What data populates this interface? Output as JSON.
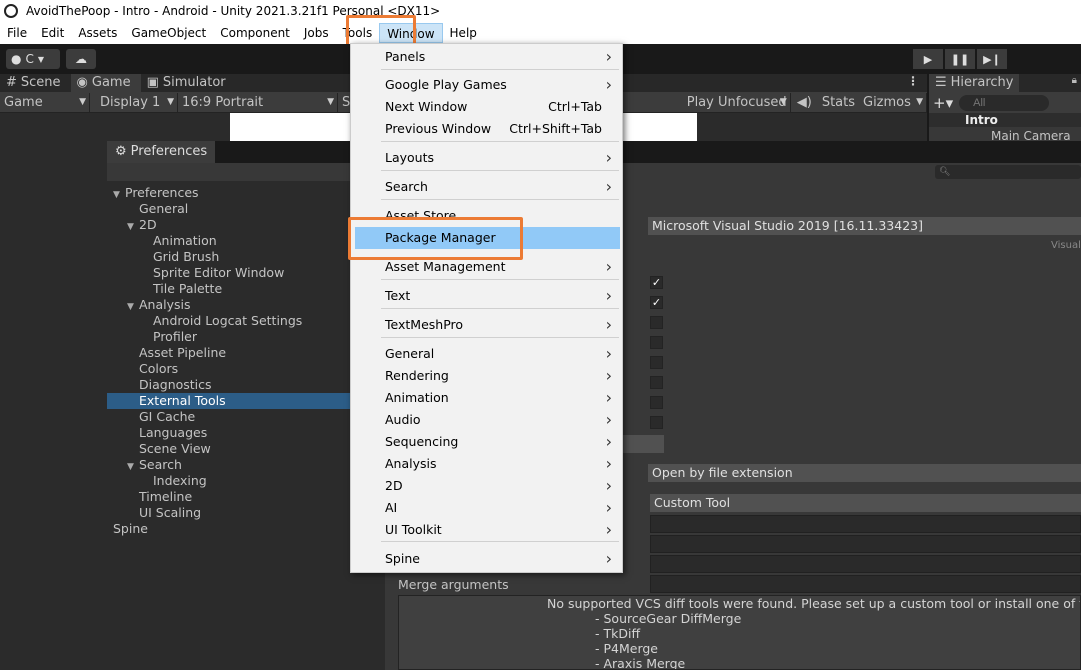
{
  "title": "AvoidThePoop - Intro - Android - Unity 2021.3.21f1 Personal <DX11>",
  "menubar": [
    "File",
    "Edit",
    "Assets",
    "GameObject",
    "Component",
    "Jobs",
    "Tools",
    "Window",
    "Help"
  ],
  "toolbar": {
    "account_initial": "C"
  },
  "tabs": {
    "scene": "Scene",
    "game": "Game",
    "simulator": "Simulator"
  },
  "gamebar": {
    "mode": "Game",
    "display": "Display 1",
    "aspect": "16:9 Portrait",
    "scale_fragment": "S",
    "play_focus": "Play Unfocused",
    "stats": "Stats",
    "gizmos": "Gizmos"
  },
  "hierarchy": {
    "tab": "Hierarchy",
    "search_placeholder": "All",
    "scene": "Intro",
    "camera": "Main Camera"
  },
  "preferences": {
    "tab": "Preferences",
    "tree": [
      {
        "label": "Preferences",
        "level": 0,
        "arrow": true
      },
      {
        "label": "General",
        "level": 1
      },
      {
        "label": "2D",
        "level": 1,
        "arrow": true
      },
      {
        "label": "Animation",
        "level": 2
      },
      {
        "label": "Grid Brush",
        "level": 2
      },
      {
        "label": "Sprite Editor Window",
        "level": 2
      },
      {
        "label": "Tile Palette",
        "level": 2
      },
      {
        "label": "Analysis",
        "level": 1,
        "arrow": true
      },
      {
        "label": "Android Logcat Settings",
        "level": 2
      },
      {
        "label": "Profiler",
        "level": 2
      },
      {
        "label": "Asset Pipeline",
        "level": 1
      },
      {
        "label": "Colors",
        "level": 1
      },
      {
        "label": "Diagnostics",
        "level": 1
      },
      {
        "label": "External Tools",
        "level": 1,
        "selected": true
      },
      {
        "label": "GI Cache",
        "level": 1
      },
      {
        "label": "Languages",
        "level": 1
      },
      {
        "label": "Scene View",
        "level": 1
      },
      {
        "label": "Search",
        "level": 1,
        "arrow": true
      },
      {
        "label": "Indexing",
        "level": 2
      },
      {
        "label": "Timeline",
        "level": 1
      },
      {
        "label": "UI Scaling",
        "level": 1
      },
      {
        "label": "Spine",
        "level": 0
      }
    ],
    "editor_value": "Microsoft Visual Studio 2019 [16.11.33423]",
    "editor_hint": "Visual",
    "checkboxes": [
      true,
      true,
      false,
      false,
      false,
      false,
      false,
      false
    ],
    "open_by": "Open by file extension",
    "tool": "Custom Tool",
    "merge_label": "Merge arguments",
    "message": [
      "No supported VCS diff tools were found. Please set up a custom tool or install one of the followin",
      "- SourceGear DiffMerge",
      "- TkDiff",
      "- P4Merge",
      "- Araxis Merge"
    ]
  },
  "window_menu": {
    "items": [
      {
        "label": "Panels",
        "arrow": true
      },
      {
        "label": "Google Play Games",
        "arrow": true
      },
      {
        "label": "Next Window",
        "shortcut": "Ctrl+Tab"
      },
      {
        "label": "Previous Window",
        "shortcut": "Ctrl+Shift+Tab"
      },
      {
        "label": "Layouts",
        "arrow": true
      },
      {
        "label": "Search",
        "arrow": true
      },
      {
        "label": "Asset Store"
      },
      {
        "label": "Package Manager",
        "highlighted": true
      },
      {
        "label": "Asset Management",
        "arrow": true
      },
      {
        "label": "Text",
        "arrow": true
      },
      {
        "label": "TextMeshPro",
        "arrow": true
      },
      {
        "label": "General",
        "arrow": true
      },
      {
        "label": "Rendering",
        "arrow": true
      },
      {
        "label": "Animation",
        "arrow": true
      },
      {
        "label": "Audio",
        "arrow": true
      },
      {
        "label": "Sequencing",
        "arrow": true
      },
      {
        "label": "Analysis",
        "arrow": true
      },
      {
        "label": "2D",
        "arrow": true
      },
      {
        "label": "AI",
        "arrow": true
      },
      {
        "label": "UI Toolkit",
        "arrow": true
      },
      {
        "label": "Spine",
        "arrow": true
      }
    ]
  },
  "colors": {
    "highlight_box": "#ec7b34",
    "menu_hover": "#91c9f7",
    "tree_selected": "#2c5d87"
  }
}
